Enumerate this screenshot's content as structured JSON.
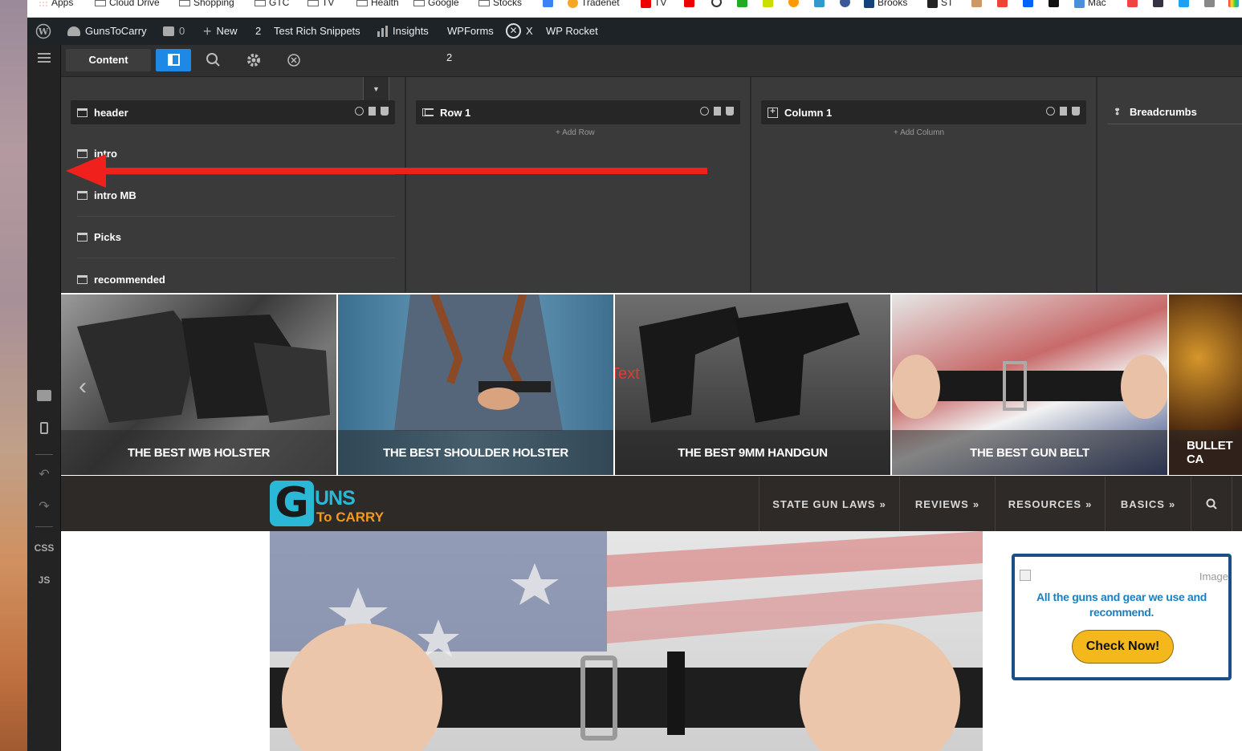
{
  "bookmarks": [
    {
      "label": "Apps",
      "icon": "apps-grid-icon"
    },
    {
      "label": "Cloud Drive",
      "icon": "folder-icon"
    },
    {
      "label": "Shopping",
      "icon": "folder-icon"
    },
    {
      "label": "GTC",
      "icon": "folder-icon"
    },
    {
      "label": "TV",
      "icon": "folder-icon"
    },
    {
      "label": "Health",
      "icon": "folder-icon"
    },
    {
      "label": "Google",
      "icon": "folder-icon"
    },
    {
      "label": "Stocks",
      "icon": "folder-icon"
    },
    {
      "label": "Tradenet",
      "icon": "tradenet-icon"
    },
    {
      "label": "TV",
      "icon": "youtube-icon"
    },
    {
      "label": "Brooks",
      "icon": "b-icon"
    },
    {
      "label": "ST",
      "icon": "st-icon"
    },
    {
      "label": "Mac",
      "icon": "mac-icon"
    }
  ],
  "wp_admin": {
    "site_name": "GunsToCarry",
    "comments_count": "0",
    "new_label": "New",
    "updates_count": "2",
    "rich_snippets": "Test Rich Snippets",
    "insights": "Insights",
    "wpforms": "WPForms",
    "x_label": "X",
    "rocket": "WP Rocket"
  },
  "toolbar": {
    "content_label": "Content",
    "counter": "2"
  },
  "left_bar": {
    "css_label": "CSS",
    "js_label": "JS"
  },
  "panels": {
    "col1": {
      "header": "header",
      "items": [
        "intro",
        "intro MB",
        "Picks",
        "recommended"
      ]
    },
    "col2": {
      "header": "Row 1",
      "add": "+ Add Row"
    },
    "col3": {
      "header": "Column 1",
      "add": "+ Add Column"
    },
    "col4": {
      "header": "Breadcrumbs"
    }
  },
  "tiles": [
    {
      "caption": "THE BEST IWB HOLSTER"
    },
    {
      "caption": "THE BEST SHOULDER HOLSTER"
    },
    {
      "caption": "THE BEST 9MM HANDGUN"
    },
    {
      "caption": "THE BEST GUN BELT"
    },
    {
      "caption": "BULLET CA"
    }
  ],
  "text_overlay": "Text",
  "logo": {
    "big": "G",
    "line1": "UNS",
    "line2": "To CARRY"
  },
  "nav": [
    "STATE GUN LAWS",
    "REVIEWS",
    "RESOURCES",
    "BASICS"
  ],
  "widget": {
    "image_alt": "Image",
    "text": "All the guns and gear we use and recommend.",
    "button": "Check Now!"
  },
  "colors": {
    "accent": "#1e88e5",
    "arrow": "#f0201c",
    "logo_cyan": "#2bb8d6",
    "logo_orange": "#f39a1c",
    "widget_border": "#1a4f87",
    "button": "#f5b81c"
  }
}
